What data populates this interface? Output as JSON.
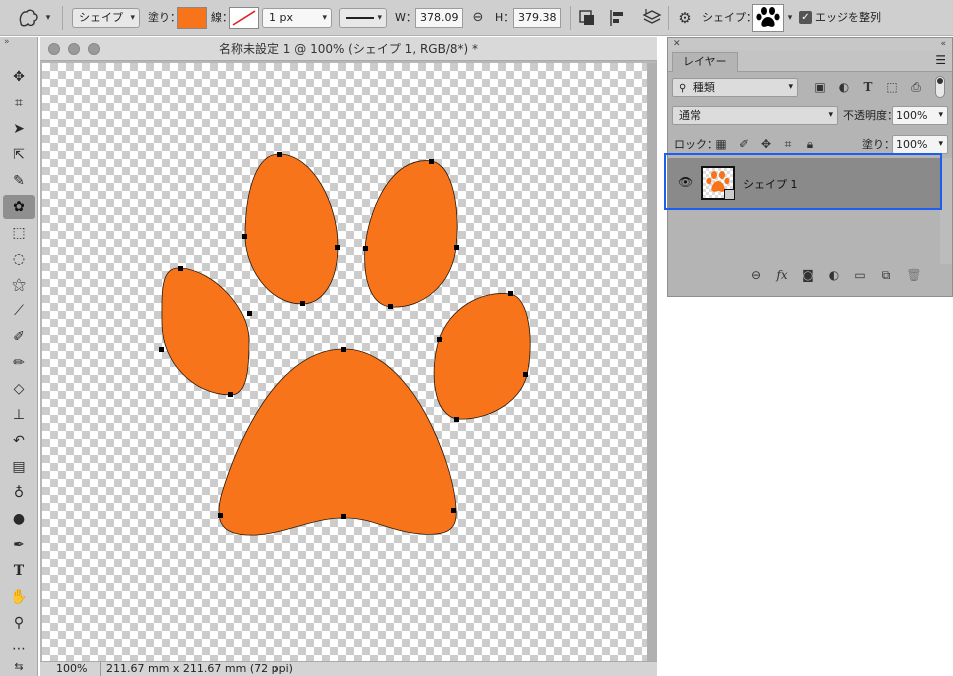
{
  "options_bar": {
    "mode": "シェイプ",
    "fill_label": "塗り：",
    "fill_color": "#f7741a",
    "stroke_label": "線：",
    "stroke_width": "1 px",
    "w_label": "W：",
    "w_value": "378.09",
    "h_label": "H：",
    "h_value": "379.38",
    "shape_label": "シェイプ：",
    "align_edges_label": "エッジを整列"
  },
  "document": {
    "title": "名称未設定 1 @ 100% (シェイプ 1, RGB/8*) *",
    "zoom": "100%",
    "doc_info": "211.67 mm x 211.67 mm (72 ppi)",
    "shape_color": "#f7741a"
  },
  "layers_panel": {
    "tab_label": "レイヤー",
    "filter_kind": "種類",
    "blend_mode": "通常",
    "opacity_label": "不透明度：",
    "opacity_value": "100%",
    "lock_label": "ロック：",
    "fill_label": "塗り：",
    "fill_value": "100%",
    "layer_name": "シェイプ 1"
  },
  "colors": {
    "selection_outline": "#1b5ef0"
  }
}
